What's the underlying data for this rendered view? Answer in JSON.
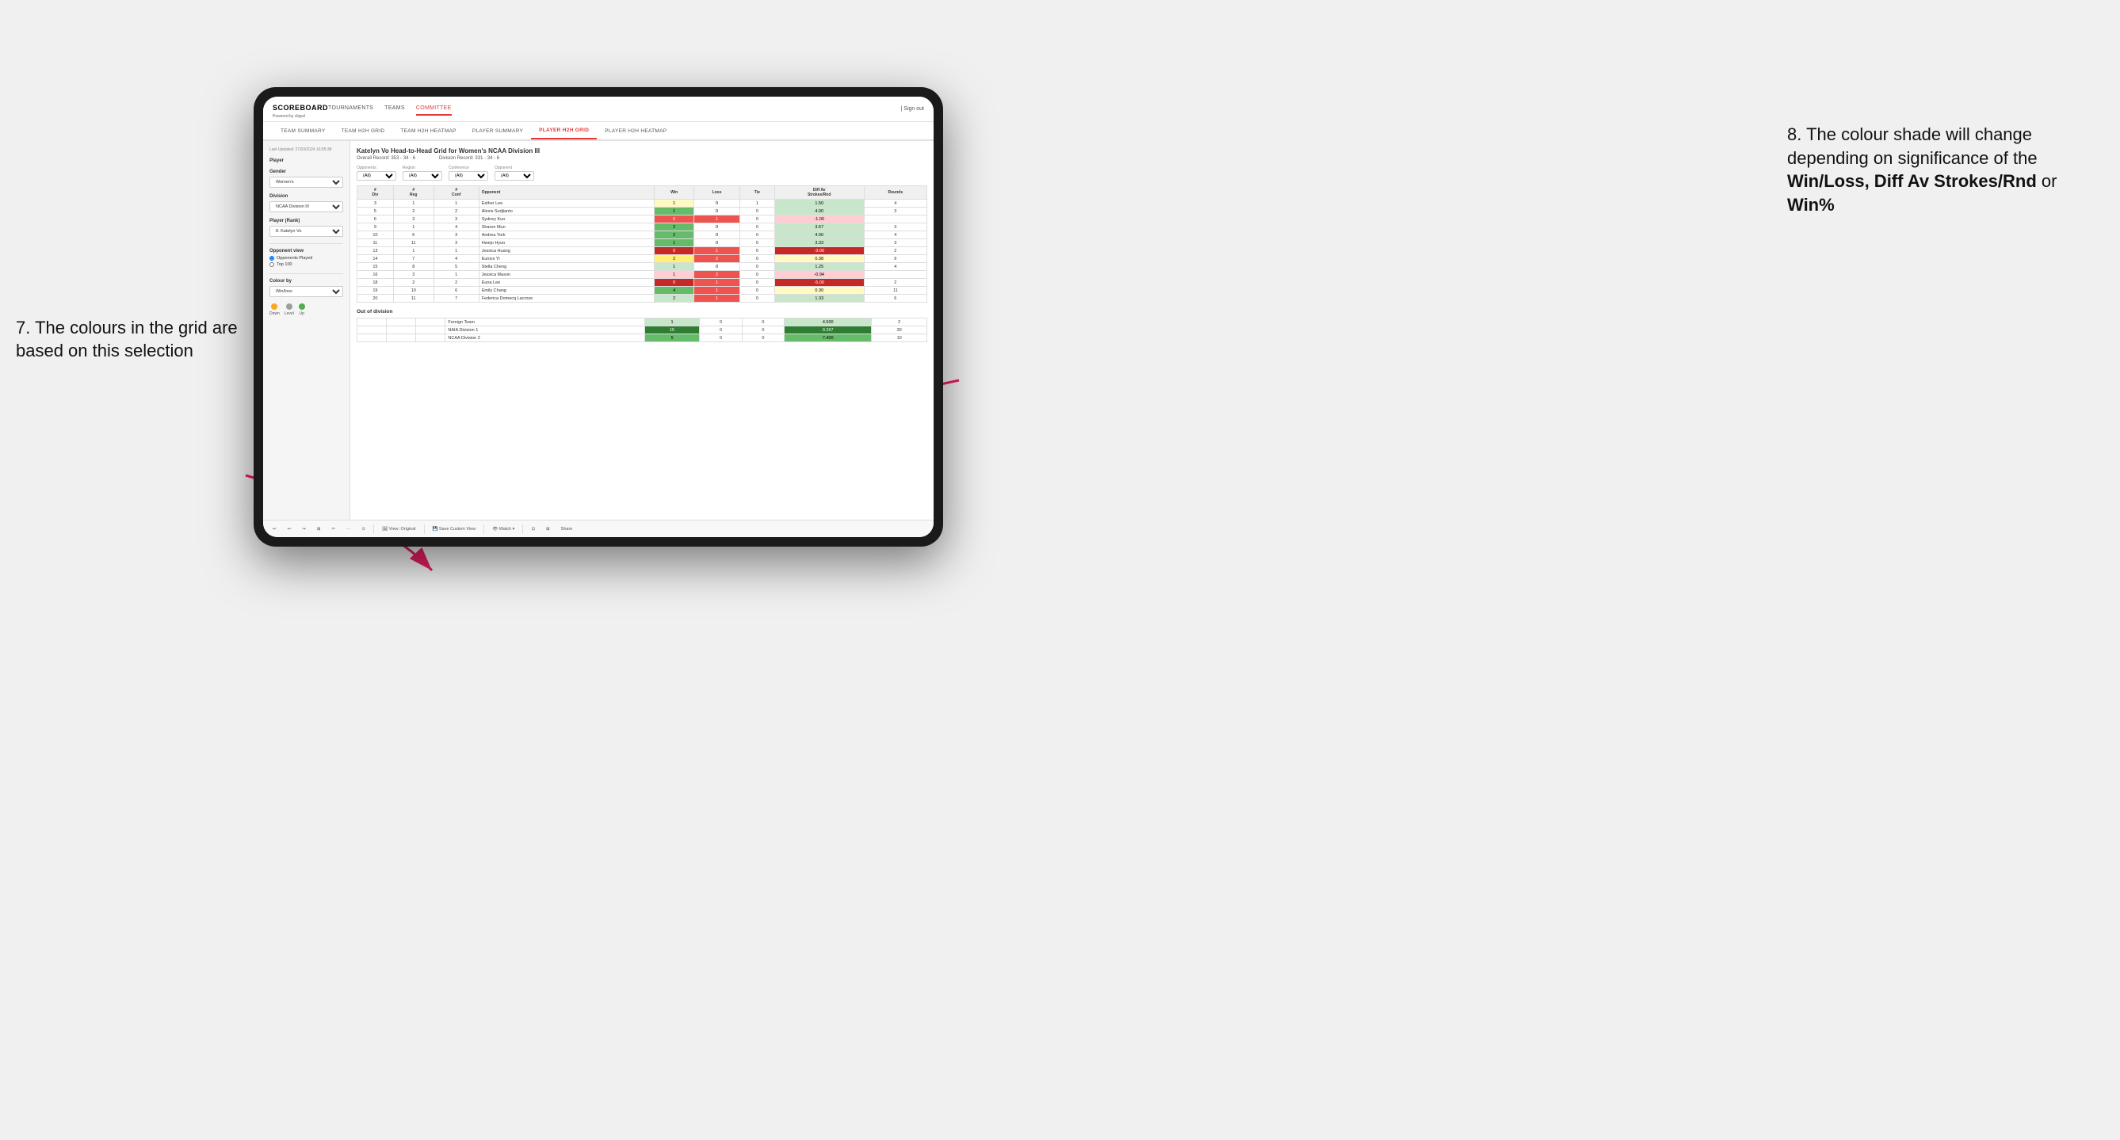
{
  "annotations": {
    "left_title": "7. The colours in the grid are based on this selection",
    "right_title": "8. The colour shade will change depending on significance of the ",
    "right_bold": "Win/Loss, Diff Av Strokes/Rnd",
    "right_suffix": " or ",
    "right_bold2": "Win%"
  },
  "nav": {
    "logo": "SCOREBOARD",
    "logo_sub": "Powered by clippd",
    "items": [
      "TOURNAMENTS",
      "TEAMS",
      "COMMITTEE"
    ],
    "active": "COMMITTEE",
    "right": "| Sign out"
  },
  "tabs": {
    "items": [
      "TEAM SUMMARY",
      "TEAM H2H GRID",
      "TEAM H2H HEATMAP",
      "PLAYER SUMMARY",
      "PLAYER H2H GRID",
      "PLAYER H2H HEATMAP"
    ],
    "active": "PLAYER H2H GRID"
  },
  "sidebar": {
    "timestamp": "Last Updated: 27/03/2024 16:55:38",
    "player_label": "Player",
    "gender_label": "Gender",
    "gender_value": "Women's",
    "division_label": "Division",
    "division_value": "NCAA Division III",
    "player_rank_label": "Player (Rank)",
    "player_rank_value": "8. Katelyn Vo",
    "opponent_view_label": "Opponent view",
    "radio1": "Opponents Played",
    "radio2": "Top 100",
    "colour_by_label": "Colour by",
    "colour_by_value": "Win/loss",
    "legend": {
      "down_color": "#f9a825",
      "level_color": "#9e9e9e",
      "up_color": "#4caf50",
      "down_label": "Down",
      "level_label": "Level",
      "up_label": "Up"
    }
  },
  "grid": {
    "title": "Katelyn Vo Head-to-Head Grid for Women's NCAA Division III",
    "overall_record": "Overall Record: 353 - 34 - 6",
    "division_record": "Division Record: 331 - 34 - 6",
    "filters": {
      "opponents_label": "Opponents:",
      "opponents_value": "(All)",
      "region_label": "Region",
      "region_value": "(All)",
      "conference_label": "Conference",
      "conference_value": "(All)",
      "opponent_label": "Opponent",
      "opponent_value": "(All)"
    },
    "columns": [
      "#\nDiv",
      "#\nReg",
      "#\nConf",
      "Opponent",
      "Win",
      "Loss",
      "Tie",
      "Diff Av\nStrokes/Rnd",
      "Rounds"
    ],
    "rows": [
      {
        "div": "3",
        "reg": "1",
        "conf": "1",
        "name": "Esther Lee",
        "win": 1,
        "loss": 0,
        "tie": 1,
        "diff": "1.50",
        "rounds": 4,
        "win_color": "yellow",
        "diff_color": "green-light"
      },
      {
        "div": "5",
        "reg": "2",
        "conf": "2",
        "name": "Alexis Sudjianto",
        "win": 1,
        "loss": 0,
        "tie": 0,
        "diff": "4.00",
        "rounds": 3,
        "win_color": "win-med",
        "diff_color": "win-light"
      },
      {
        "div": "6",
        "reg": "3",
        "conf": "3",
        "name": "Sydney Kuo",
        "win": 0,
        "loss": 1,
        "tie": 0,
        "diff": "-1.00",
        "rounds": "",
        "win_color": "loss-med",
        "diff_color": "loss-light"
      },
      {
        "div": "9",
        "reg": "1",
        "conf": "4",
        "name": "Sharon Mun",
        "win": 2,
        "loss": 0,
        "tie": 0,
        "diff": "3.67",
        "rounds": 3,
        "win_color": "win-med",
        "diff_color": "win-light"
      },
      {
        "div": "10",
        "reg": "6",
        "conf": "3",
        "name": "Andrea York",
        "win": 2,
        "loss": 0,
        "tie": 0,
        "diff": "4.00",
        "rounds": 4,
        "win_color": "win-med",
        "diff_color": "win-light"
      },
      {
        "div": "11",
        "reg": "11",
        "conf": "3",
        "name": "Hwejo Hyun",
        "win": 1,
        "loss": 0,
        "tie": 0,
        "diff": "3.33",
        "rounds": 3,
        "win_color": "win-med",
        "diff_color": "win-light"
      },
      {
        "div": "13",
        "reg": "1",
        "conf": "1",
        "name": "Jessica Huang",
        "win": 0,
        "loss": 1,
        "tie": 0,
        "diff": "-3.00",
        "rounds": 2,
        "win_color": "loss-dark",
        "diff_color": "loss-dark"
      },
      {
        "div": "14",
        "reg": "7",
        "conf": "4",
        "name": "Eunice Yi",
        "win": 2,
        "loss": 2,
        "tie": 0,
        "diff": "0.38",
        "rounds": 9,
        "win_color": "yellow-med",
        "diff_color": "yellow"
      },
      {
        "div": "15",
        "reg": "8",
        "conf": "5",
        "name": "Stella Cheng",
        "win": 1,
        "loss": 0,
        "tie": 0,
        "diff": "1.25",
        "rounds": 4,
        "win_color": "win-light",
        "diff_color": "green-light"
      },
      {
        "div": "16",
        "reg": "3",
        "conf": "1",
        "name": "Jessica Mason",
        "win": 1,
        "loss": 2,
        "tie": 0,
        "diff": "-0.94",
        "rounds": "",
        "win_color": "loss-light",
        "diff_color": "loss-light"
      },
      {
        "div": "18",
        "reg": "2",
        "conf": "2",
        "name": "Euna Lee",
        "win": 0,
        "loss": 1,
        "tie": 0,
        "diff": "-5.00",
        "rounds": 2,
        "win_color": "loss-dark",
        "diff_color": "loss-dark"
      },
      {
        "div": "19",
        "reg": "10",
        "conf": "6",
        "name": "Emily Chang",
        "win": 4,
        "loss": 1,
        "tie": 0,
        "diff": "0.30",
        "rounds": 11,
        "win_color": "win-med",
        "diff_color": "yellow"
      },
      {
        "div": "20",
        "reg": "11",
        "conf": "7",
        "name": "Federica Domecq Lacroze",
        "win": 2,
        "loss": 1,
        "tie": 0,
        "diff": "1.33",
        "rounds": 6,
        "win_color": "win-light",
        "diff_color": "green-light"
      }
    ],
    "out_division_label": "Out of division",
    "out_division_rows": [
      {
        "name": "Foreign Team",
        "win": 1,
        "loss": 0,
        "tie": 0,
        "diff": "4.500",
        "rounds": 2,
        "win_color": "win-light",
        "diff_color": "win-light"
      },
      {
        "name": "NAIA Division 1",
        "win": 15,
        "loss": 0,
        "tie": 0,
        "diff": "9.267",
        "rounds": 30,
        "win_color": "win-dark",
        "diff_color": "win-dark"
      },
      {
        "name": "NCAA Division 2",
        "win": 5,
        "loss": 0,
        "tie": 0,
        "diff": "7.400",
        "rounds": 10,
        "win_color": "win-med",
        "diff_color": "win-med"
      }
    ]
  },
  "toolbar": {
    "items": [
      "↩",
      "↪",
      "⟳",
      "⊞",
      "✂",
      "·",
      "⊙",
      "|",
      "🖼 View: Original",
      "|",
      "💾 Save Custom View",
      "|",
      "👁 Watch ▾",
      "|",
      "⊡",
      "⊞",
      "Share"
    ]
  }
}
